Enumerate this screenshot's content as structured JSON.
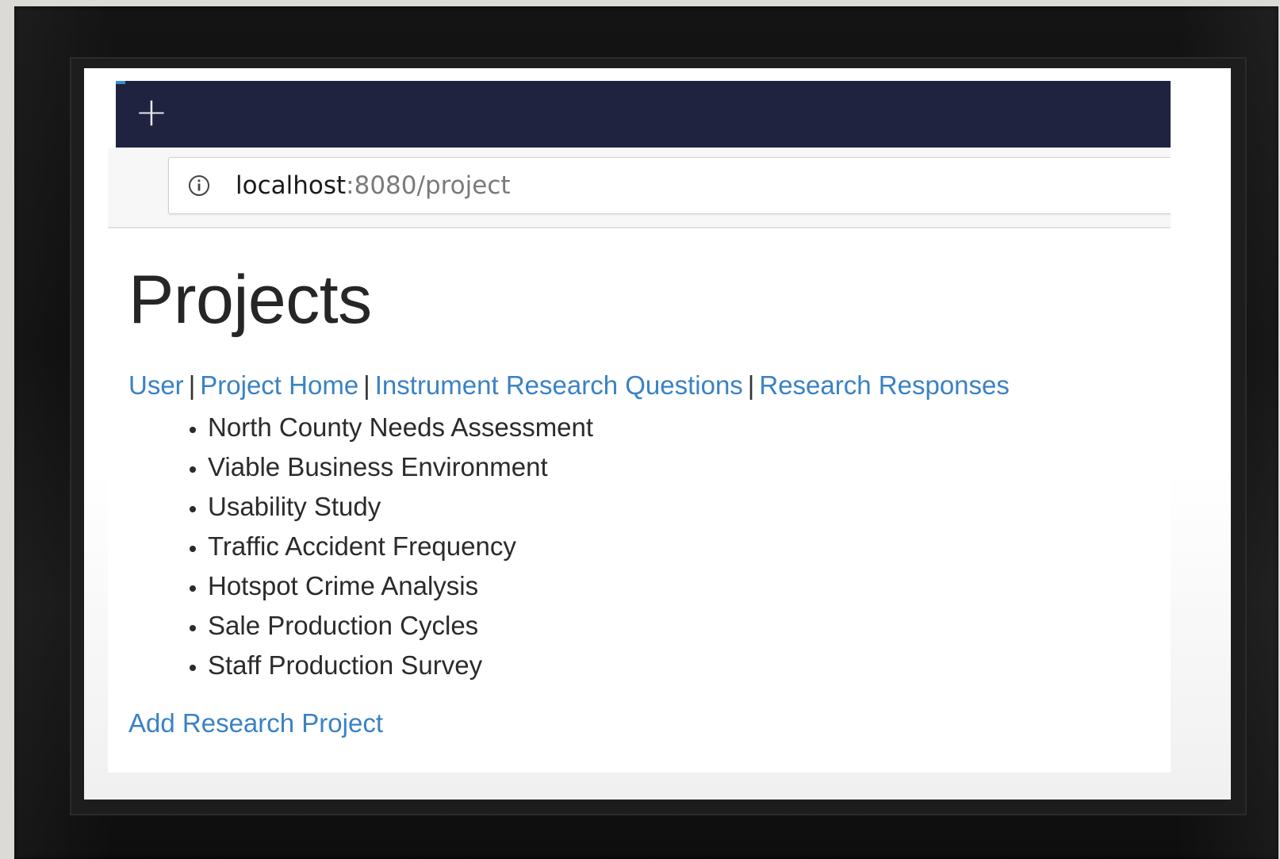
{
  "browser": {
    "new_tab_glyph": "+",
    "url_host": "localhost",
    "url_path": ":8080/project"
  },
  "page": {
    "title": "Projects",
    "nav_links": [
      {
        "label": "User"
      },
      {
        "label": "Project Home"
      },
      {
        "label": "Instrument Research Questions"
      },
      {
        "label": "Research Responses"
      }
    ],
    "separator": "|",
    "projects": [
      "North County Needs Assessment",
      "Viable Business Environment",
      "Usability Study",
      "Traffic Accident Frequency",
      "Hotspot Crime Analysis",
      "Sale Production Cycles",
      "Staff Production Survey"
    ],
    "add_link_label": "Add Research Project"
  },
  "colors": {
    "tabbar": "#20233f",
    "link": "#3a82c4",
    "text": "#2b2b2b"
  },
  "icons": {
    "site_info": "info-circle-icon",
    "new_tab": "plus-icon"
  }
}
